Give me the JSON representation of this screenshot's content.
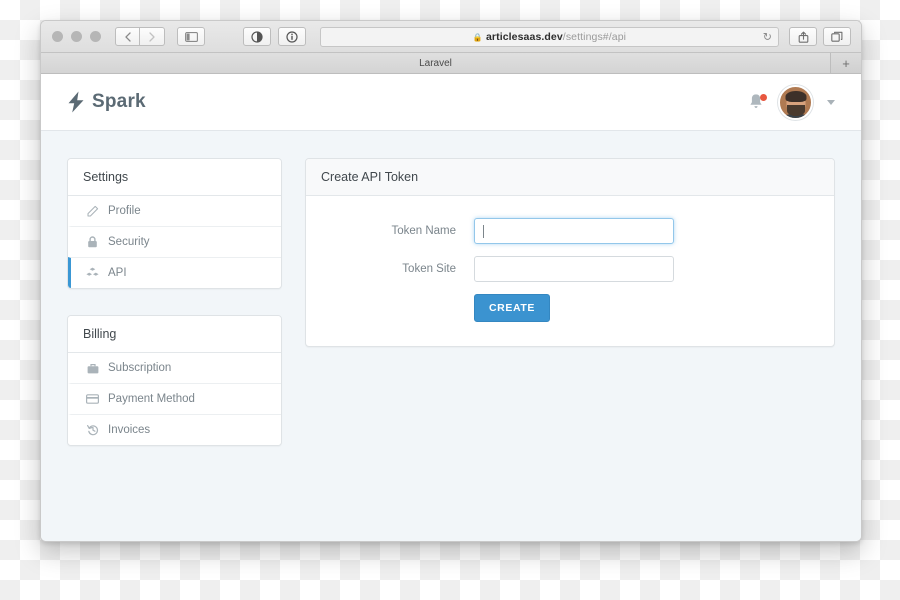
{
  "browser": {
    "tab_title": "Laravel",
    "new_tab_label": "+",
    "url_domain": "articlesaas.dev",
    "url_path": "/settings#/api",
    "lock_icon": "lock-icon",
    "reload_label": "↻",
    "back_label": "‹",
    "forward_label": "›",
    "sidebar_toggle_icon": "sidebar-toggle-icon",
    "reader_icon": "reader-view-icon",
    "info_icon": "info-icon",
    "share_icon": "share-icon",
    "tabs_overview_icon": "tabs-overview-icon"
  },
  "navbar": {
    "brand": "Spark",
    "brand_icon": "lightning-bolt-icon",
    "bell_icon": "bell-icon",
    "notification_badge": "",
    "avatar_alt": "user-avatar",
    "caret_icon": "chevron-down-icon"
  },
  "sidebar": {
    "settings": {
      "title": "Settings",
      "items": [
        {
          "label": "Profile",
          "icon": "edit-icon",
          "glyph": "✎",
          "active": false
        },
        {
          "label": "Security",
          "icon": "lock-icon",
          "glyph": "ὑ2",
          "active": false
        },
        {
          "label": "API",
          "icon": "cubes-icon",
          "glyph": "❖",
          "active": true
        }
      ]
    },
    "billing": {
      "title": "Billing",
      "items": [
        {
          "label": "Subscription",
          "icon": "briefcase-icon",
          "glyph": "▬",
          "active": false
        },
        {
          "label": "Payment Method",
          "icon": "credit-card-icon",
          "glyph": "▤",
          "active": false
        },
        {
          "label": "Invoices",
          "icon": "history-icon",
          "glyph": "↺",
          "active": false
        }
      ]
    }
  },
  "main": {
    "panel_title": "Create API Token",
    "fields": [
      {
        "label": "Token Name",
        "value": "",
        "placeholder": "",
        "focused": true
      },
      {
        "label": "Token Site",
        "value": "",
        "placeholder": "",
        "focused": false
      }
    ],
    "submit_label": "CREATE"
  },
  "colors": {
    "accent": "#3b93d0",
    "page_bg": "#f2f6f9",
    "brand_text": "#5b6a74",
    "badge": "#e8573f"
  }
}
